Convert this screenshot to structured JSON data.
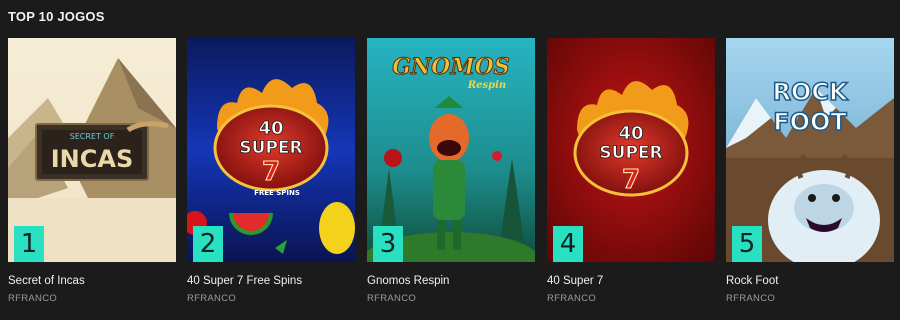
{
  "section": {
    "title": "TOP 10 JOGOS"
  },
  "games": [
    {
      "rank": "1",
      "name": "Secret of Incas",
      "provider": "RFRANCO",
      "art_top": "SECRET OF",
      "art_main": "INCAS"
    },
    {
      "rank": "2",
      "name": "40 Super 7 Free Spins",
      "provider": "RFRANCO",
      "art_top": "40",
      "art_main": "SUPER",
      "art_sub": "7",
      "art_tag": "FREE SPINS"
    },
    {
      "rank": "3",
      "name": "Gnomos Respin",
      "provider": "RFRANCO",
      "art_top": "GNOMOS",
      "art_main": "Respin"
    },
    {
      "rank": "4",
      "name": "40 Super 7",
      "provider": "RFRANCO",
      "art_top": "40",
      "art_main": "SUPER",
      "art_sub": "7"
    },
    {
      "rank": "5",
      "name": "Rock Foot",
      "provider": "RFRANCO",
      "art_top": "ROCK",
      "art_main": "FOOT"
    }
  ],
  "colors": {
    "rank_badge": "#2ae0c2",
    "background": "#1b1b1b"
  }
}
